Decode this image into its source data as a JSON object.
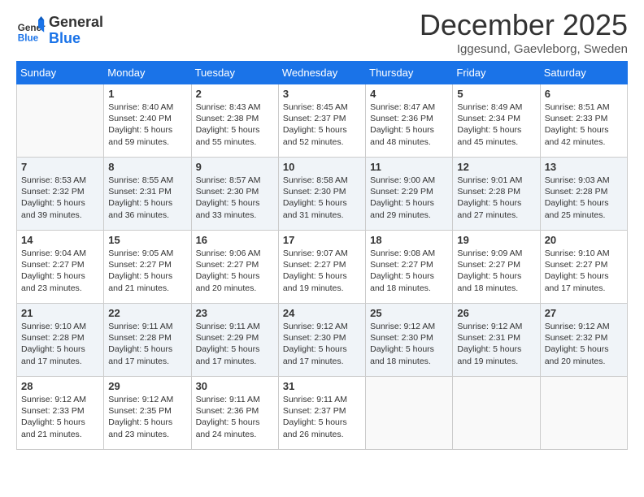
{
  "header": {
    "logo_general": "General",
    "logo_blue": "Blue",
    "month_title": "December 2025",
    "location": "Iggesund, Gaevleborg, Sweden"
  },
  "days_of_week": [
    "Sunday",
    "Monday",
    "Tuesday",
    "Wednesday",
    "Thursday",
    "Friday",
    "Saturday"
  ],
  "weeks": [
    [
      {
        "day": "",
        "info": ""
      },
      {
        "day": "1",
        "info": "Sunrise: 8:40 AM\nSunset: 2:40 PM\nDaylight: 5 hours\nand 59 minutes."
      },
      {
        "day": "2",
        "info": "Sunrise: 8:43 AM\nSunset: 2:38 PM\nDaylight: 5 hours\nand 55 minutes."
      },
      {
        "day": "3",
        "info": "Sunrise: 8:45 AM\nSunset: 2:37 PM\nDaylight: 5 hours\nand 52 minutes."
      },
      {
        "day": "4",
        "info": "Sunrise: 8:47 AM\nSunset: 2:36 PM\nDaylight: 5 hours\nand 48 minutes."
      },
      {
        "day": "5",
        "info": "Sunrise: 8:49 AM\nSunset: 2:34 PM\nDaylight: 5 hours\nand 45 minutes."
      },
      {
        "day": "6",
        "info": "Sunrise: 8:51 AM\nSunset: 2:33 PM\nDaylight: 5 hours\nand 42 minutes."
      }
    ],
    [
      {
        "day": "7",
        "info": "Sunrise: 8:53 AM\nSunset: 2:32 PM\nDaylight: 5 hours\nand 39 minutes."
      },
      {
        "day": "8",
        "info": "Sunrise: 8:55 AM\nSunset: 2:31 PM\nDaylight: 5 hours\nand 36 minutes."
      },
      {
        "day": "9",
        "info": "Sunrise: 8:57 AM\nSunset: 2:30 PM\nDaylight: 5 hours\nand 33 minutes."
      },
      {
        "day": "10",
        "info": "Sunrise: 8:58 AM\nSunset: 2:30 PM\nDaylight: 5 hours\nand 31 minutes."
      },
      {
        "day": "11",
        "info": "Sunrise: 9:00 AM\nSunset: 2:29 PM\nDaylight: 5 hours\nand 29 minutes."
      },
      {
        "day": "12",
        "info": "Sunrise: 9:01 AM\nSunset: 2:28 PM\nDaylight: 5 hours\nand 27 minutes."
      },
      {
        "day": "13",
        "info": "Sunrise: 9:03 AM\nSunset: 2:28 PM\nDaylight: 5 hours\nand 25 minutes."
      }
    ],
    [
      {
        "day": "14",
        "info": "Sunrise: 9:04 AM\nSunset: 2:27 PM\nDaylight: 5 hours\nand 23 minutes."
      },
      {
        "day": "15",
        "info": "Sunrise: 9:05 AM\nSunset: 2:27 PM\nDaylight: 5 hours\nand 21 minutes."
      },
      {
        "day": "16",
        "info": "Sunrise: 9:06 AM\nSunset: 2:27 PM\nDaylight: 5 hours\nand 20 minutes."
      },
      {
        "day": "17",
        "info": "Sunrise: 9:07 AM\nSunset: 2:27 PM\nDaylight: 5 hours\nand 19 minutes."
      },
      {
        "day": "18",
        "info": "Sunrise: 9:08 AM\nSunset: 2:27 PM\nDaylight: 5 hours\nand 18 minutes."
      },
      {
        "day": "19",
        "info": "Sunrise: 9:09 AM\nSunset: 2:27 PM\nDaylight: 5 hours\nand 18 minutes."
      },
      {
        "day": "20",
        "info": "Sunrise: 9:10 AM\nSunset: 2:27 PM\nDaylight: 5 hours\nand 17 minutes."
      }
    ],
    [
      {
        "day": "21",
        "info": "Sunrise: 9:10 AM\nSunset: 2:28 PM\nDaylight: 5 hours\nand 17 minutes."
      },
      {
        "day": "22",
        "info": "Sunrise: 9:11 AM\nSunset: 2:28 PM\nDaylight: 5 hours\nand 17 minutes."
      },
      {
        "day": "23",
        "info": "Sunrise: 9:11 AM\nSunset: 2:29 PM\nDaylight: 5 hours\nand 17 minutes."
      },
      {
        "day": "24",
        "info": "Sunrise: 9:12 AM\nSunset: 2:30 PM\nDaylight: 5 hours\nand 17 minutes."
      },
      {
        "day": "25",
        "info": "Sunrise: 9:12 AM\nSunset: 2:30 PM\nDaylight: 5 hours\nand 18 minutes."
      },
      {
        "day": "26",
        "info": "Sunrise: 9:12 AM\nSunset: 2:31 PM\nDaylight: 5 hours\nand 19 minutes."
      },
      {
        "day": "27",
        "info": "Sunrise: 9:12 AM\nSunset: 2:32 PM\nDaylight: 5 hours\nand 20 minutes."
      }
    ],
    [
      {
        "day": "28",
        "info": "Sunrise: 9:12 AM\nSunset: 2:33 PM\nDaylight: 5 hours\nand 21 minutes."
      },
      {
        "day": "29",
        "info": "Sunrise: 9:12 AM\nSunset: 2:35 PM\nDaylight: 5 hours\nand 23 minutes."
      },
      {
        "day": "30",
        "info": "Sunrise: 9:11 AM\nSunset: 2:36 PM\nDaylight: 5 hours\nand 24 minutes."
      },
      {
        "day": "31",
        "info": "Sunrise: 9:11 AM\nSunset: 2:37 PM\nDaylight: 5 hours\nand 26 minutes."
      },
      {
        "day": "",
        "info": ""
      },
      {
        "day": "",
        "info": ""
      },
      {
        "day": "",
        "info": ""
      }
    ]
  ]
}
